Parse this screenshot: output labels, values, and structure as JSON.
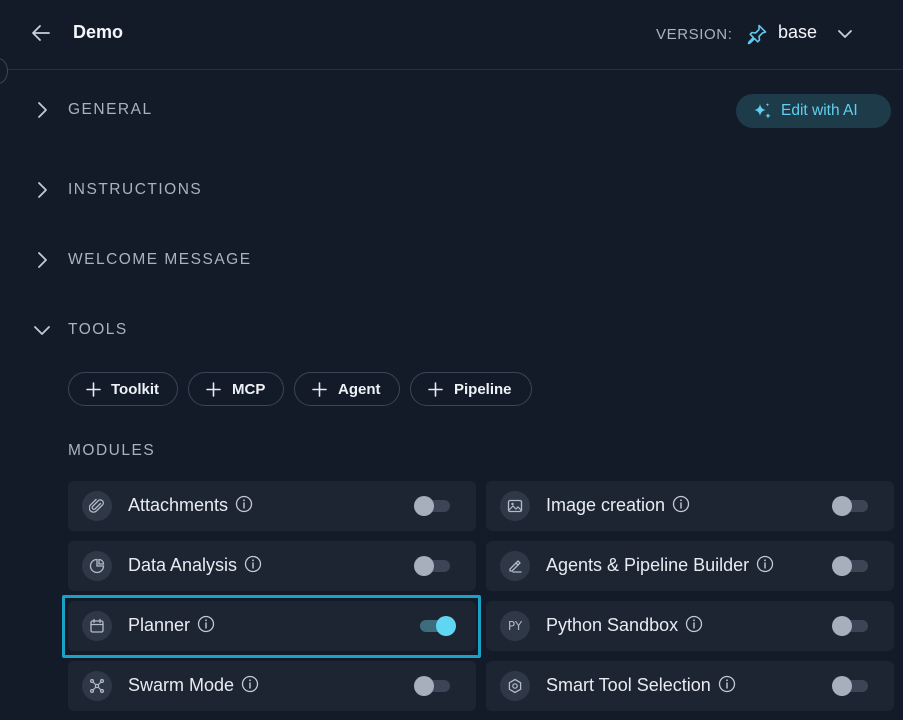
{
  "header": {
    "title": "Demo",
    "version_label": "VERSION:",
    "version_value": "base"
  },
  "sections": {
    "general": "GENERAL",
    "instructions": "INSTRUCTIONS",
    "welcome": "WELCOME MESSAGE",
    "tools": "TOOLS"
  },
  "edit_ai": "Edit with AI",
  "tool_buttons": [
    "Toolkit",
    "MCP",
    "Agent",
    "Pipeline"
  ],
  "modules": {
    "label": "MODULES",
    "items": [
      {
        "name": "Attachments",
        "icon": "paperclip-icon",
        "enabled": false
      },
      {
        "name": "Image creation",
        "icon": "image-icon",
        "enabled": false
      },
      {
        "name": "Data Analysis",
        "icon": "chart-icon",
        "enabled": false
      },
      {
        "name": "Agents & Pipeline Builder",
        "icon": "builder-icon",
        "enabled": false
      },
      {
        "name": "Planner",
        "icon": "calendar-icon",
        "enabled": true
      },
      {
        "name": "Python Sandbox",
        "icon": "python-icon",
        "icon_text": "PY",
        "enabled": false
      },
      {
        "name": "Swarm Mode",
        "icon": "swarm-icon",
        "enabled": false
      },
      {
        "name": "Smart Tool Selection",
        "icon": "hexagon-icon",
        "enabled": false
      }
    ]
  },
  "colors": {
    "background": "#141b28",
    "card": "#1e2532",
    "accent": "#5fd6f2",
    "highlight": "#1aa2c6"
  }
}
